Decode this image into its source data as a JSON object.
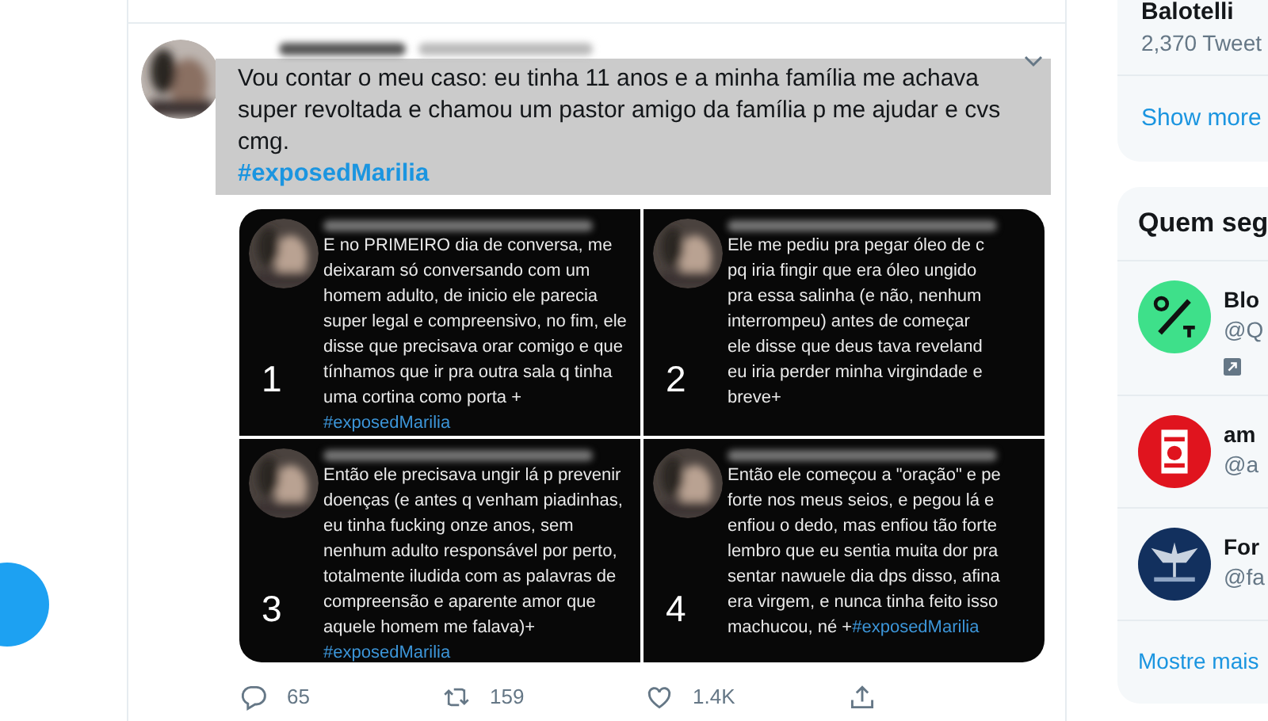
{
  "tweet": {
    "highlighted": true,
    "text": "Vou contar o meu caso: eu tinha 11 anos e a minha família me achava super revoltada e chamou um pastor amigo da família p me ajudar e cvs cmg.",
    "hashtag": "#exposedMarilia",
    "images": [
      {
        "number": "1",
        "lines": [
          "E no PRIMEIRO dia de conversa, me",
          "deixaram só conversando com um",
          "homem adulto, de inicio ele parecia",
          "super legal e compreensivo, no fim, ele",
          "disse que precisava orar comigo e que",
          "tínhamos que ir pra outra sala q tinha",
          "uma cortina como porta +"
        ],
        "hashtag": "#exposedMarilia",
        "hashtag_inline": false
      },
      {
        "number": "2",
        "lines": [
          "Ele me pediu pra pegar óleo de c",
          "pq iria fingir que era óleo ungido",
          "pra essa salinha (e não, nenhum",
          "interrompeu) antes de começar",
          "ele disse que deus tava reveland",
          "eu iria perder minha virgindade e",
          "breve+"
        ]
      },
      {
        "number": "3",
        "lines": [
          "Então ele precisava ungir lá p prevenir",
          "doenças (e antes q venham piadinhas,",
          "eu tinha fucking onze anos, sem",
          "nenhum adulto responsável por perto,",
          "totalmente iludida com as palavras de",
          "compreensão e aparente amor que",
          "aquele homem me falava)+"
        ],
        "hashtag": "#exposedMarilia",
        "hashtag_inline": false
      },
      {
        "number": "4",
        "lines": [
          "Então ele começou a \"oração\" e pe",
          "forte nos meus seios, e pegou lá e",
          "enfiou o dedo, mas enfiou tão forte",
          "lembro que eu sentia muita dor pra",
          "sentar nawuele dia dps disso, afina",
          "era virgem, e nunca tinha feito isso",
          "machucou, né +"
        ],
        "hashtag": "#exposedMarilia",
        "hashtag_inline": true
      }
    ],
    "actions": [
      {
        "kind": "reply",
        "count": "65"
      },
      {
        "kind": "retweet",
        "count": "159"
      },
      {
        "kind": "like",
        "count": "1.4K"
      },
      {
        "kind": "share"
      }
    ]
  },
  "sidebar": {
    "profile_card": {
      "name": "Balotelli",
      "tweets": "2,370 Tweet",
      "link": "Show more"
    },
    "who_to_follow": {
      "title": "Quem seg",
      "accounts": [
        {
          "kind": "qt",
          "name": "Blo",
          "handle": "@Q",
          "promoted": true
        },
        {
          "kind": "a",
          "name": "am",
          "handle": "@a",
          "promoted": false
        },
        {
          "kind": "wings",
          "name": "For",
          "handle": "@fa",
          "promoted": false
        }
      ],
      "link": "Mostre mais"
    }
  }
}
